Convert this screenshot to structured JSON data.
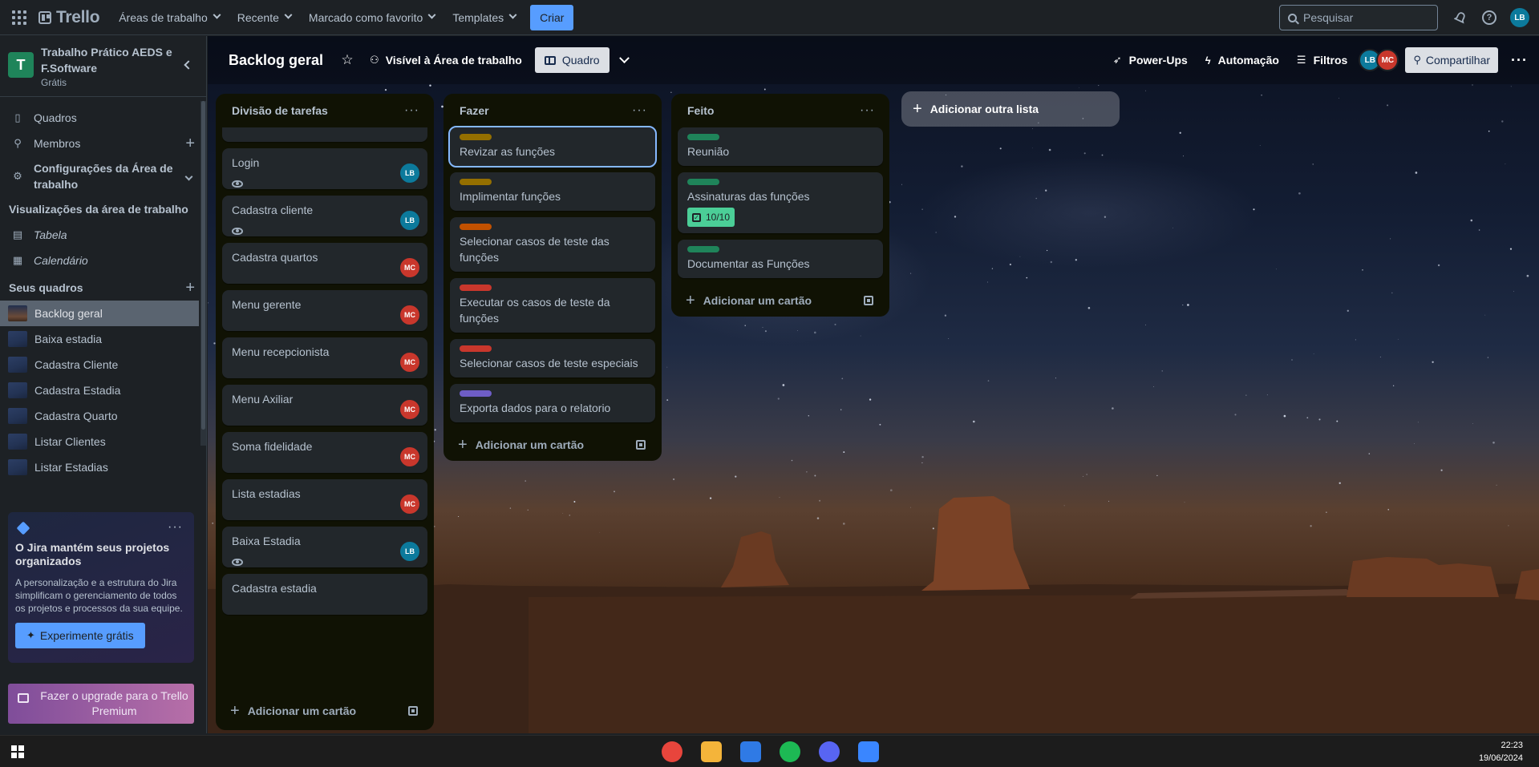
{
  "topbar": {
    "logo": "Trello",
    "nav": [
      "Áreas de trabalho",
      "Recente",
      "Marcado como favorito",
      "Templates"
    ],
    "create": "Criar",
    "search_placeholder": "Pesquisar",
    "user_initials": "LB"
  },
  "sidebar": {
    "workspace_initial": "T",
    "workspace_name": "Trabalho Prático AEDS e F.Software",
    "workspace_plan": "Grátis",
    "items": [
      {
        "label": "Quadros",
        "icon": "trello-board-icon"
      },
      {
        "label": "Membros",
        "icon": "person-icon"
      },
      {
        "label": "Configurações da Área de trabalho",
        "icon": "gear-icon"
      }
    ],
    "views_heading": "Visualizações da área de trabalho",
    "views": [
      {
        "label": "Tabela",
        "icon": "table-icon"
      },
      {
        "label": "Calendário",
        "icon": "calendar-icon"
      }
    ],
    "boards_heading": "Seus quadros",
    "boards": [
      "Backlog geral",
      "Baixa estadia",
      "Cadastra Cliente",
      "Cadastra Estadia",
      "Cadastra Quarto",
      "Listar Clientes",
      "Listar Estadias"
    ],
    "active_board_index": 0,
    "jira": {
      "title": "O Jira mantém seus projetos organizados",
      "body": "A personalização e a estrutura do Jira simplificam o gerenciamento de todos os projetos e processos da sua equipe.",
      "button": "Experimente grátis"
    },
    "upgrade": "Fazer o upgrade para o Trello Premium"
  },
  "board": {
    "title": "Backlog geral",
    "visibility": "Visível à Área de trabalho",
    "view": "Quadro",
    "powerups": "Power-Ups",
    "automation": "Automação",
    "filters": "Filtros",
    "members": [
      {
        "initials": "LB",
        "color": "#0c7a9c"
      },
      {
        "initials": "MC",
        "color": "#c9372c"
      }
    ],
    "share": "Compartilhar",
    "add_list": "Adicionar outra lista",
    "add_card": "Adicionar um cartão"
  },
  "lists": [
    {
      "title": "Divisão de tarefas",
      "cards": [
        {
          "title": "Login",
          "watch": true,
          "member": "LB"
        },
        {
          "title": "Cadastra cliente",
          "watch": true,
          "member": "LB"
        },
        {
          "title": "Cadastra quartos",
          "watch": false,
          "member": "MC"
        },
        {
          "title": "Menu gerente",
          "watch": false,
          "member": "MC"
        },
        {
          "title": "Menu recepcionista",
          "watch": false,
          "member": "MC"
        },
        {
          "title": "Menu Axiliar",
          "watch": false,
          "member": "MC"
        },
        {
          "title": "Soma fidelidade",
          "watch": false,
          "member": "MC"
        },
        {
          "title": "Lista estadias",
          "watch": false,
          "member": "MC"
        },
        {
          "title": "Baixa Estadia",
          "watch": true,
          "member": "LB"
        },
        {
          "title": "Cadastra estadia",
          "watch": false,
          "member": ""
        }
      ]
    },
    {
      "title": "Fazer",
      "cards": [
        {
          "title": "Revizar as funções",
          "label_color": "#946f00"
        },
        {
          "title": "Implimentar funções",
          "label_color": "#946f00"
        },
        {
          "title": "Selecionar casos de teste das funções",
          "label_color": "#c25100"
        },
        {
          "title": "Executar os casos de teste da funções",
          "label_color": "#c9372c"
        },
        {
          "title": "Selecionar casos de teste especiais",
          "label_color": "#c9372c"
        },
        {
          "title": "Exporta dados para o relatorio",
          "label_color": "#6e5dc6"
        }
      ]
    },
    {
      "title": "Feito",
      "cards": [
        {
          "title": "Reunião",
          "label_color": "#1f845a"
        },
        {
          "title": "Assinaturas das funções",
          "label_color": "#1f845a",
          "checklist": "10/10"
        },
        {
          "title": "Documentar as Funções",
          "label_color": "#1f845a"
        }
      ]
    }
  ],
  "taskbar": {
    "time": "22:23",
    "date": "19/06/2024",
    "apps": [
      "chrome-icon",
      "file-explorer-icon",
      "store-icon",
      "spotify-icon",
      "discord-icon",
      "app-icon"
    ]
  }
}
